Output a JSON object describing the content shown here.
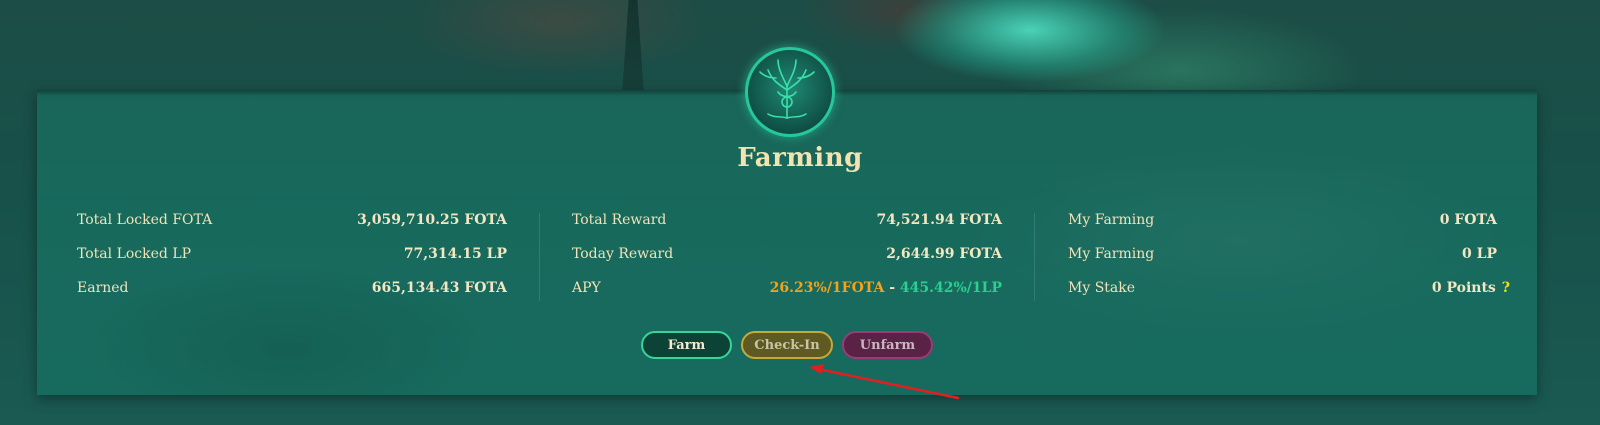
{
  "header": {
    "title": "Farming",
    "logo_icon": "tree-emblem-icon"
  },
  "stats": {
    "col1": [
      {
        "label": "Total Locked FOTA",
        "value": "3,059,710.25 FOTA"
      },
      {
        "label": "Total Locked LP",
        "value": "77,314.15 LP"
      },
      {
        "label": "Earned",
        "value": "665,134.43 FOTA"
      }
    ],
    "col2": [
      {
        "label": "Total Reward",
        "value": "74,521.94 FOTA"
      },
      {
        "label": "Today Reward",
        "value": "2,644.99 FOTA"
      },
      {
        "label": "APY",
        "apy_fota": "26.23%/1FOTA",
        "separator": " - ",
        "apy_lp": "445.42%/1LP"
      }
    ],
    "col3": [
      {
        "label": "My Farming",
        "value": "0 FOTA"
      },
      {
        "label": "My Farming",
        "value": "0 LP"
      },
      {
        "label": "My Stake",
        "value": "0 Points",
        "help": "?"
      }
    ]
  },
  "actions": {
    "farm": "Farm",
    "check_in": "Check-In",
    "unfarm": "Unfarm"
  },
  "colors": {
    "accent": "#f3e3b0",
    "apy_fota": "#f2a31b",
    "apy_lp": "#29d08f",
    "annotation_arrow": "#e02020"
  }
}
